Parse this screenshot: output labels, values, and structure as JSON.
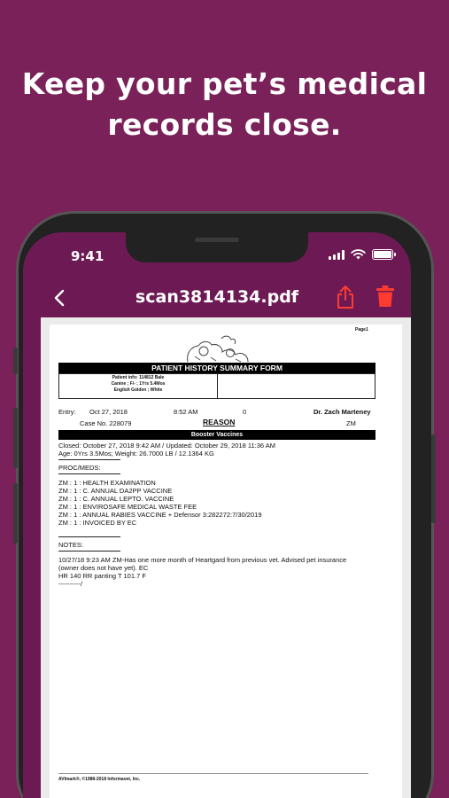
{
  "headline": {
    "line1": "Keep your pet’s medical",
    "line2": "records close."
  },
  "status_bar": {
    "time": "9:41"
  },
  "nav": {
    "title": "scan3814134.pdf",
    "accent_color": "#ff3b30"
  },
  "document": {
    "page_label": "Page1",
    "form_title": "PATIENT HISTORY SUMMARY FORM",
    "patient_info": {
      "line1": "Patient info: 114812 Bale",
      "line2": "Canine ; F/- ; 1Yrs 5.4Mos",
      "line3": "English Golden ; White"
    },
    "entry": {
      "label": "Entry:",
      "date": "Oct 27, 2018",
      "time": "8:52 AM",
      "code": "0",
      "doctor": "Dr. Zach Marteney"
    },
    "case": {
      "number": "Case No. 228079",
      "reason_label": "REASON",
      "initials": "ZM"
    },
    "reason_value": "Booster Vaccines",
    "closed_line": "Closed: October 27, 2018 9:42 AM / Updated: October 29, 2018 11:36 AM",
    "age_line": "Age: 0Yrs  3.5Mos;  Weight: 26.7000 LB / 12.1364 KG",
    "proc_meds_label": "PROC/MEDS:",
    "proc_meds": [
      "ZM : 1 : HEALTH EXAMINATION",
      "ZM : 1 : C. ANNUAL DA2PP VACCINE",
      "ZM : 1 : C. ANNUAL LEPTO. VACCINE",
      "ZM : 1 : ENVIROSAFE MEDICAL WASTE FEE",
      "ZM : 1 : ANNUAL RABIES VACCINE + Defensor 3:282272:7/30/2019",
      "ZM : 1 : INVOICED BY EC"
    ],
    "notes_label": "NOTES:",
    "notes": [
      "10/27/18 9:23 AM ZM-Has one more month of Heartgard from previous vet. Advised pet insurance",
      "(owner does not have yet). EC",
      "HR 140 RR panting T 101.7 F",
      "----------/"
    ],
    "footer": "AVImark®, ©1988-2018 Informavet, Inc."
  }
}
